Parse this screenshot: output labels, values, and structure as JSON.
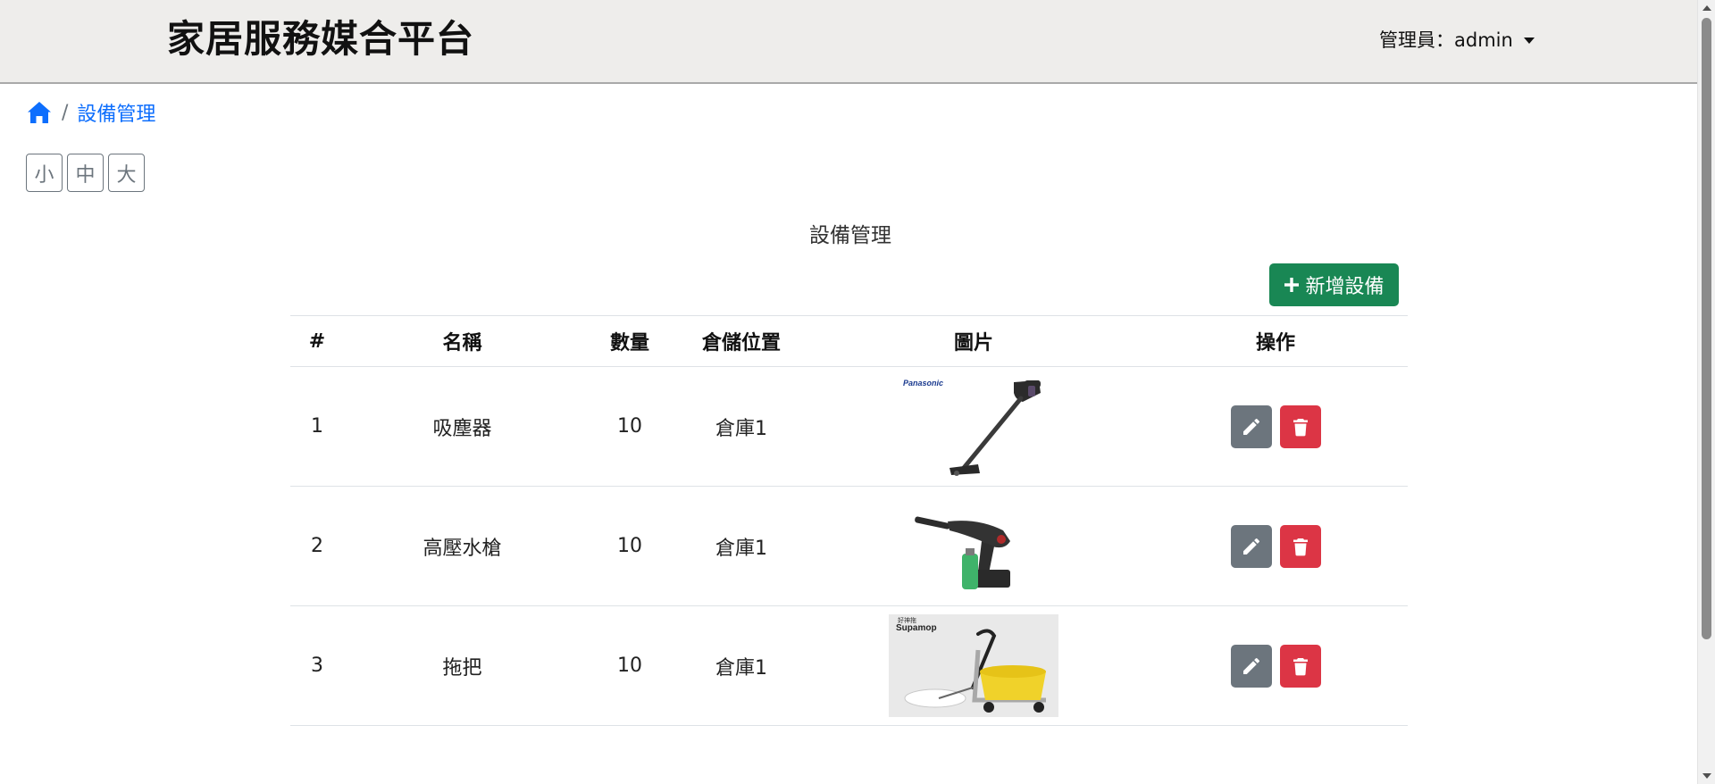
{
  "header": {
    "brand": "家居服務媒合平台",
    "user_label": "管理員：admin"
  },
  "breadcrumb": {
    "separator": "/",
    "current": "設備管理"
  },
  "font_sizes": [
    "小",
    "中",
    "大"
  ],
  "section_title": "設備管理",
  "add_button": {
    "label": "新增設備",
    "color": "#198754"
  },
  "table": {
    "headers": [
      "#",
      "名稱",
      "數量",
      "倉儲位置",
      "圖片",
      "操作"
    ],
    "rows": [
      {
        "idx": "1",
        "name": "吸塵器",
        "qty": "10",
        "location": "倉庫1",
        "image_brand": "Panasonic"
      },
      {
        "idx": "2",
        "name": "高壓水槍",
        "qty": "10",
        "location": "倉庫1"
      },
      {
        "idx": "3",
        "name": "拖把",
        "qty": "10",
        "location": "倉庫1",
        "image_brand": "Supamop",
        "image_brand_cn": "好神拖"
      }
    ]
  },
  "colors": {
    "link": "#0d6efd",
    "edit": "#6c757d",
    "delete": "#dc3545",
    "header_bg": "#eeedeb"
  },
  "icons": {
    "home": "home-icon",
    "plus": "plus-icon",
    "edit": "pencil-icon",
    "delete": "trash-icon",
    "user_menu": "caret-down-icon"
  }
}
